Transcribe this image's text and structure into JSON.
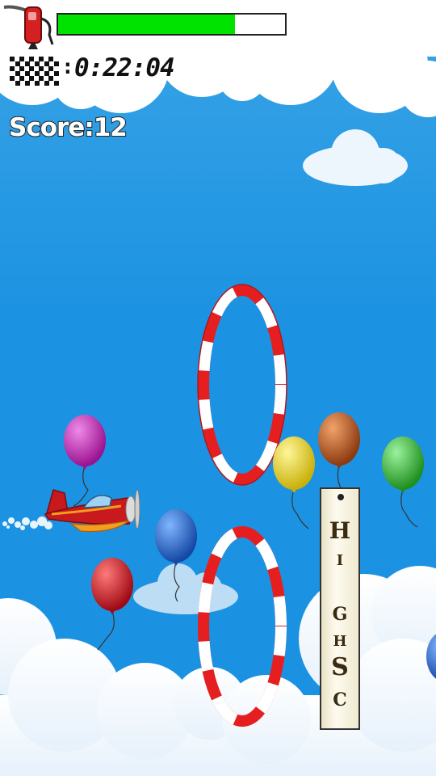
{
  "hud": {
    "fuel_icon": "fuel-pump-icon",
    "fuel_level": 0.78,
    "fuel_color": "#00e200",
    "race_icon": "checkered-flag-icon",
    "timer": "0:22:04",
    "score_text": "Score:12"
  },
  "banner": {
    "letters": [
      "H",
      "I",
      "G",
      "H",
      "S",
      "C"
    ]
  },
  "colors": {
    "sky": "#1b92e1",
    "ring_red": "#e51f1f",
    "ring_white": "#ffffff",
    "plane_body": "#c8191e"
  },
  "balloons": [
    {
      "name": "balloon-purple",
      "color": "#b31fa5"
    },
    {
      "name": "balloon-blue",
      "color": "#1c5fbf"
    },
    {
      "name": "balloon-red",
      "color": "#c01020"
    },
    {
      "name": "balloon-yellow",
      "color": "#e6d21c"
    },
    {
      "name": "balloon-brown",
      "color": "#b0501c"
    },
    {
      "name": "balloon-green",
      "color": "#2fb52f"
    },
    {
      "name": "balloon-blue-partial",
      "color": "#1c5fbf"
    }
  ]
}
